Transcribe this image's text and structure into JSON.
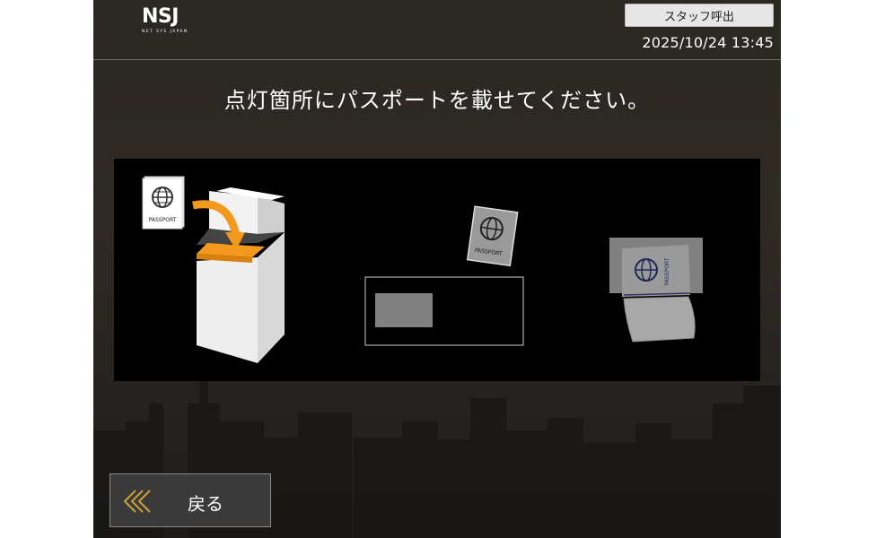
{
  "header": {
    "logo_text": "NSJ",
    "logo_subtext": "NET SYS JAPAN",
    "staff_call_label": "スタッフ呼出",
    "datetime": "2025/10/24 13:45"
  },
  "main": {
    "instruction": "点灯箇所にパスポートを載せてください。",
    "illustrations": {
      "passport_label": "PASSPORT",
      "highlight_color": "#f39a1e"
    }
  },
  "footer": {
    "back_label": "戻る",
    "back_icon": "double-chevron-left-icon",
    "back_icon_color": "#c9a23a"
  },
  "colors": {
    "background": "#2b2723",
    "panel": "#000000",
    "accent": "#f39a1e"
  }
}
